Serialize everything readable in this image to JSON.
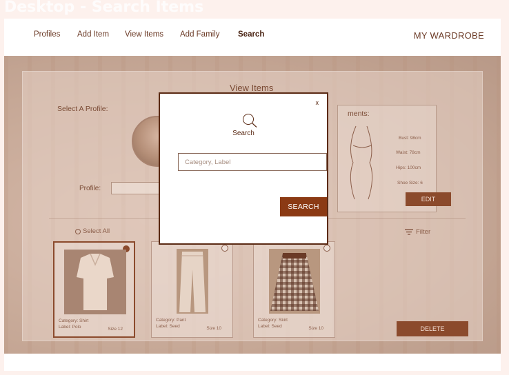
{
  "frame_title": "Desktop - Search Items",
  "nav": {
    "links": [
      "Profiles",
      "Add Item",
      "View Items",
      "Add Family",
      "Search"
    ],
    "active": "Search",
    "brand": "MY WARDROBE"
  },
  "page": {
    "title": "View Items",
    "select_profile_label": "Select A Profile:",
    "profile_label": "Profile:",
    "measurements_title": "ments:",
    "measurements": [
      "Bust: 98cm",
      "Waist: 78cm",
      "Hips: 100cm",
      "Shoe Size: 6"
    ],
    "edit_label": "EDIT",
    "select_all_label": "Select All",
    "filter_label": "Filter",
    "delete_label": "DELETE"
  },
  "cards": [
    {
      "category": "Category: Shirt",
      "label": "Label: Polo",
      "size": "Size 12",
      "selected": true
    },
    {
      "category": "Category: Pant",
      "label": "Label: Seed",
      "size": "Size 10",
      "selected": false
    },
    {
      "category": "Category: Skirt",
      "label": "Label: Seed",
      "size": "Size 10",
      "selected": false
    }
  ],
  "modal": {
    "close": "x",
    "title": "Search",
    "input_placeholder": "Category, Label",
    "input_value": "",
    "button_label": "SEARCH"
  },
  "colors": {
    "accent": "#8b3a14",
    "text": "#5a2a14",
    "background": "#fdf1ed"
  },
  "icons": [
    "search-icon",
    "filter-icon",
    "close-icon"
  ]
}
